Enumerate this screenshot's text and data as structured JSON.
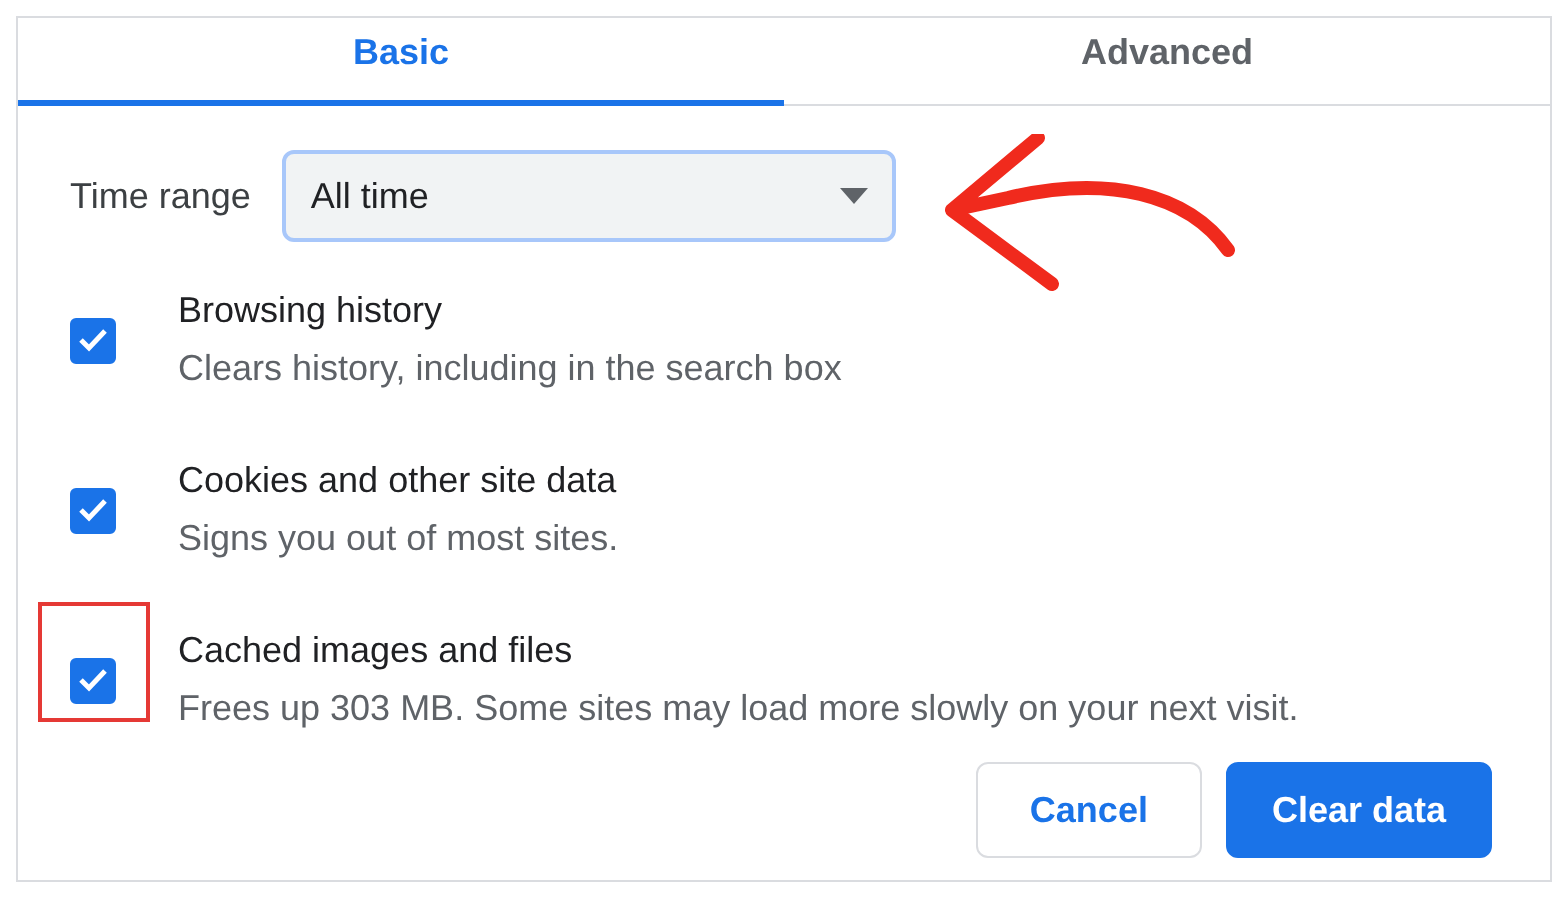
{
  "tabs": [
    {
      "label": "Basic",
      "selected": true
    },
    {
      "label": "Advanced",
      "selected": false
    }
  ],
  "time_range": {
    "label": "Time range",
    "value": "All time",
    "pointed_at": true
  },
  "items": [
    {
      "title": "Browsing history",
      "description": "Clears history, including in the search box",
      "checked": true,
      "highlighted": false
    },
    {
      "title": "Cookies and other site data",
      "description": "Signs you out of most sites.",
      "checked": true,
      "highlighted": false
    },
    {
      "title": "Cached images and files",
      "description": "Frees up 303 MB. Some sites may load more slowly on your next visit.",
      "checked": true,
      "highlighted": true
    }
  ],
  "buttons": [
    {
      "label": "Cancel",
      "kind": "secondary"
    },
    {
      "label": "Clear data",
      "kind": "primary"
    }
  ]
}
